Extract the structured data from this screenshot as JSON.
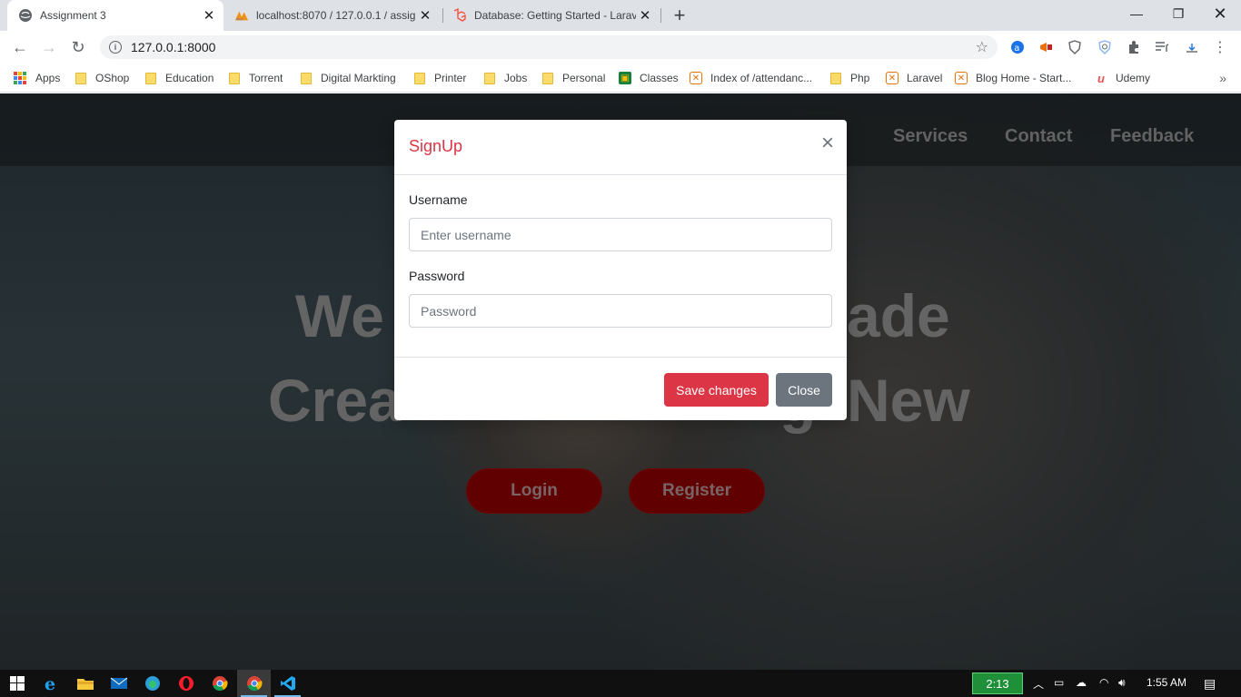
{
  "browser": {
    "tabs": [
      {
        "title": "Assignment 3",
        "active": true
      },
      {
        "title": "localhost:8070 / 127.0.0.1 / assig",
        "active": false
      },
      {
        "title": "Database: Getting Started - Larav",
        "active": false
      }
    ],
    "url": "127.0.0.1:8000",
    "bookmarks": [
      "Apps",
      "OShop",
      "Education",
      "Torrent",
      "Digital Markting",
      "Printer",
      "Jobs",
      "Personal",
      "Classes",
      "Index of /attendanc...",
      "Php",
      "Laravel",
      "Blog Home - Start...",
      "Udemy"
    ]
  },
  "page": {
    "nav": [
      "Services",
      "Contact",
      "Feedback"
    ],
    "nav_partial": "t",
    "hero": {
      "line1_left": "We",
      "line1_right": "ade",
      "line2_left": "Crea",
      "line2_mid": "g",
      "line2_right": "New"
    },
    "buttons": {
      "login": "Login",
      "register": "Register"
    }
  },
  "modal": {
    "title": "SignUp",
    "close_glyph": "×",
    "username_label": "Username",
    "username_placeholder": "Enter username",
    "password_label": "Password",
    "password_placeholder": "Password",
    "save_label": "Save changes",
    "close_label": "Close"
  },
  "taskbar": {
    "battery_time": "2:13",
    "clock": "1:55 AM"
  },
  "colors": {
    "accent_red": "#dc3545",
    "close_gray": "#6c757d",
    "hero_button_red": "#c20000"
  }
}
